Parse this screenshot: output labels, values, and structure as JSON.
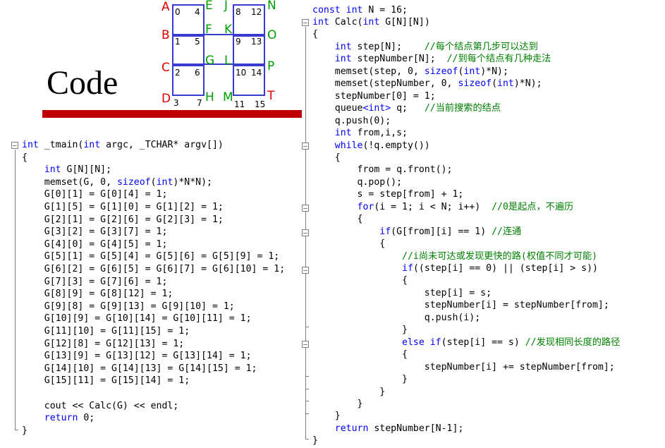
{
  "title": "Code",
  "diagram": {
    "letters": {
      "red": [
        "A",
        "B",
        "C",
        "D"
      ],
      "green_left_col": [
        "E",
        "F",
        "G",
        "H"
      ],
      "green_mid_col": [
        "J",
        "K",
        "L",
        "M"
      ],
      "green_right_col": [
        "N",
        "O",
        "P"
      ],
      "red_corner": "T"
    },
    "cells_left": [
      {
        "a": "0",
        "b": "4"
      },
      {
        "a": "1",
        "b": "5"
      },
      {
        "a": "2",
        "b": "6"
      },
      {
        "a": "3",
        "b": "7"
      }
    ],
    "cells_right": [
      {
        "a": "8",
        "b": "12"
      },
      {
        "a": "9",
        "b": "13"
      },
      {
        "a": "10",
        "b": "14"
      },
      {
        "a": "11",
        "b": "15"
      }
    ],
    "colors": {
      "edge": "#3a3ad0",
      "letter_red": "#e00000",
      "letter_green": "#00a000"
    }
  },
  "left_code": [
    [
      [
        "kw",
        "int"
      ],
      [
        "t",
        " _tmain("
      ],
      [
        "kw",
        "int"
      ],
      [
        "t",
        " argc, _TCHAR* argv[])"
      ]
    ],
    [
      [
        "t",
        "{"
      ]
    ],
    [
      [
        "t",
        "    "
      ],
      [
        "kw",
        "int"
      ],
      [
        "t",
        " G[N][N];"
      ]
    ],
    [
      [
        "t",
        "    memset(G, 0, "
      ],
      [
        "kw",
        "sizeof"
      ],
      [
        "t",
        "("
      ],
      [
        "kw",
        "int"
      ],
      [
        "t",
        ")*N*N);"
      ]
    ],
    [
      [
        "t",
        "    G[0][1] = G[0][4] = 1;"
      ]
    ],
    [
      [
        "t",
        "    G[1][5] = G[1][0] = G[1][2] = 1;"
      ]
    ],
    [
      [
        "t",
        "    G[2][1] = G[2][6] = G[2][3] = 1;"
      ]
    ],
    [
      [
        "t",
        "    G[3][2] = G[3][7] = 1;"
      ]
    ],
    [
      [
        "t",
        "    G[4][0] = G[4][5] = 1;"
      ]
    ],
    [
      [
        "t",
        "    G[5][1] = G[5][4] = G[5][6] = G[5][9] = 1;"
      ]
    ],
    [
      [
        "t",
        "    G[6][2] = G[6][5] = G[6][7] = G[6][10] = 1;"
      ]
    ],
    [
      [
        "t",
        "    G[7][3] = G[7][6] = 1;"
      ]
    ],
    [
      [
        "t",
        "    G[8][9] = G[8][12] = 1;"
      ]
    ],
    [
      [
        "t",
        "    G[9][8] = G[9][13] = G[9][10] = 1;"
      ]
    ],
    [
      [
        "t",
        "    G[10][9] = G[10][14] = G[10][11] = 1;"
      ]
    ],
    [
      [
        "t",
        "    G[11][10] = G[11][15] = 1;"
      ]
    ],
    [
      [
        "t",
        "    G[12][8] = G[12][13] = 1;"
      ]
    ],
    [
      [
        "t",
        "    G[13][9] = G[13][12] = G[13][14] = 1;"
      ]
    ],
    [
      [
        "t",
        "    G[14][10] = G[14][13] = G[14][15] = 1;"
      ]
    ],
    [
      [
        "t",
        "    G[15][11] = G[15][14] = 1;"
      ]
    ],
    [
      [
        "t",
        ""
      ]
    ],
    [
      [
        "t",
        "    cout << Calc(G) << endl;"
      ]
    ],
    [
      [
        "t",
        "    "
      ],
      [
        "kw",
        "return"
      ],
      [
        "t",
        " 0;"
      ]
    ],
    [
      [
        "t",
        "}"
      ]
    ]
  ],
  "right_code_first": [
    [
      "kw",
      "const"
    ],
    [
      "t",
      " "
    ],
    [
      "kw",
      "int"
    ],
    [
      "t",
      " N = 16;"
    ]
  ],
  "right_code": [
    [
      [
        "kw",
        "int"
      ],
      [
        "t",
        " Calc("
      ],
      [
        "kw",
        "int"
      ],
      [
        "t",
        " G[N][N])"
      ]
    ],
    [
      [
        "t",
        "{"
      ]
    ],
    [
      [
        "t",
        "    "
      ],
      [
        "kw",
        "int"
      ],
      [
        "t",
        " step[N];    "
      ],
      [
        "cm",
        "//每个结点第几步可以达到"
      ]
    ],
    [
      [
        "t",
        "    "
      ],
      [
        "kw",
        "int"
      ],
      [
        "t",
        " stepNumber[N];  "
      ],
      [
        "cm",
        "//到每个结点有几种走法"
      ]
    ],
    [
      [
        "t",
        "    memset(step, 0, "
      ],
      [
        "kw",
        "sizeof"
      ],
      [
        "t",
        "("
      ],
      [
        "kw",
        "int"
      ],
      [
        "t",
        ")*N);"
      ]
    ],
    [
      [
        "t",
        "    memset(stepNumber, 0, "
      ],
      [
        "kw",
        "sizeof"
      ],
      [
        "t",
        "("
      ],
      [
        "kw",
        "int"
      ],
      [
        "t",
        ")*N);"
      ]
    ],
    [
      [
        "t",
        "    stepNumber[0] = 1;"
      ]
    ],
    [
      [
        "t",
        "    queue"
      ],
      [
        "kw",
        "<int>"
      ],
      [
        "t",
        " q;   "
      ],
      [
        "cm",
        "//当前搜索的结点"
      ]
    ],
    [
      [
        "t",
        "    q.push(0);"
      ]
    ],
    [
      [
        "t",
        "    "
      ],
      [
        "kw",
        "int"
      ],
      [
        "t",
        " from,i,s;"
      ]
    ],
    [
      [
        "t",
        "    "
      ],
      [
        "kw",
        "while"
      ],
      [
        "t",
        "(!q.empty())"
      ]
    ],
    [
      [
        "t",
        "    {"
      ]
    ],
    [
      [
        "t",
        "        from = q.front();"
      ]
    ],
    [
      [
        "t",
        "        q.pop();"
      ]
    ],
    [
      [
        "t",
        "        s = step[from] + 1;"
      ]
    ],
    [
      [
        "t",
        "        "
      ],
      [
        "kw",
        "for"
      ],
      [
        "t",
        "(i = 1; i < N; i++)  "
      ],
      [
        "cm",
        "//0是起点，不遍历"
      ]
    ],
    [
      [
        "t",
        "        {"
      ]
    ],
    [
      [
        "t",
        "            "
      ],
      [
        "kw",
        "if"
      ],
      [
        "t",
        "(G[from][i] == 1) "
      ],
      [
        "cm",
        "//连通"
      ]
    ],
    [
      [
        "t",
        "            {"
      ]
    ],
    [
      [
        "t",
        "                "
      ],
      [
        "cm",
        "//i尚未可达或发现更快的路(权值不同才可能)"
      ]
    ],
    [
      [
        "t",
        "                "
      ],
      [
        "kw",
        "if"
      ],
      [
        "t",
        "((step[i] == 0) || (step[i] > s))"
      ]
    ],
    [
      [
        "t",
        "                {"
      ]
    ],
    [
      [
        "t",
        "                    step[i] = s;"
      ]
    ],
    [
      [
        "t",
        "                    stepNumber[i] = stepNumber[from];"
      ]
    ],
    [
      [
        "t",
        "                    q.push(i);"
      ]
    ],
    [
      [
        "t",
        "                }"
      ]
    ],
    [
      [
        "t",
        "                "
      ],
      [
        "kw",
        "else if"
      ],
      [
        "t",
        "(step[i] == s) "
      ],
      [
        "cm",
        "//发现相同长度的路径"
      ]
    ],
    [
      [
        "t",
        "                {"
      ]
    ],
    [
      [
        "t",
        "                    stepNumber[i] += stepNumber[from];"
      ]
    ],
    [
      [
        "t",
        "                }"
      ]
    ],
    [
      [
        "t",
        "            }"
      ]
    ],
    [
      [
        "t",
        "        }"
      ]
    ],
    [
      [
        "t",
        "    }"
      ]
    ],
    [
      [
        "t",
        "    "
      ],
      [
        "kw",
        "return"
      ],
      [
        "t",
        " stepNumber[N-1];"
      ]
    ],
    [
      [
        "t",
        "}"
      ]
    ]
  ]
}
